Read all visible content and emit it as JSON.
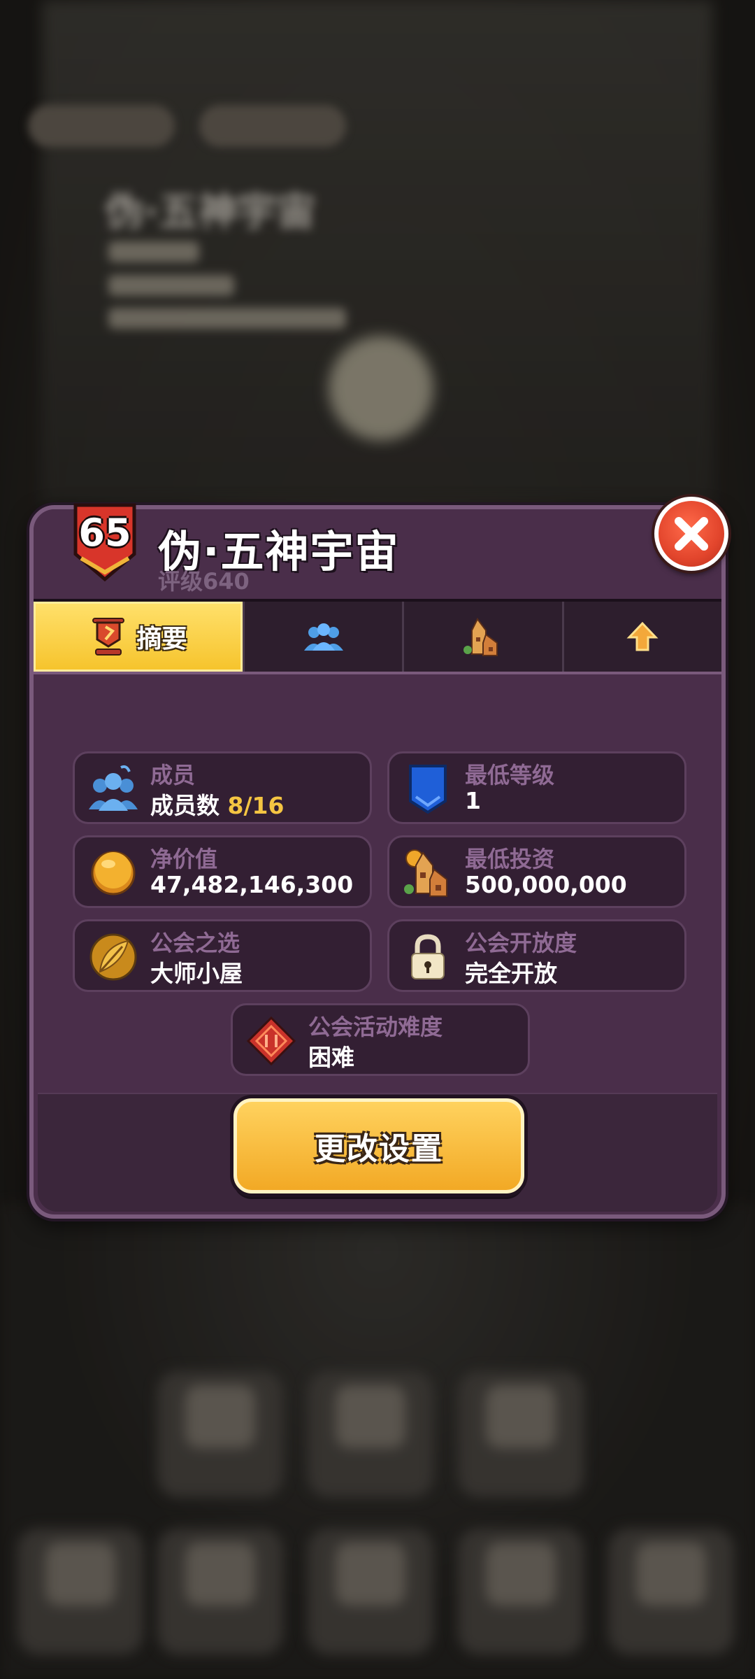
{
  "guild": {
    "level": "65",
    "name": "伪·五神宇宙",
    "rating": "评级640"
  },
  "tabs": [
    {
      "label": "摘要",
      "icon": "trophy-icon",
      "active": true
    },
    {
      "label": "",
      "icon": "members-icon",
      "active": false
    },
    {
      "label": "",
      "icon": "buildings-icon",
      "active": false
    },
    {
      "label": "",
      "icon": "upgrade-arrow-icon",
      "active": false
    }
  ],
  "stats": {
    "members": {
      "label": "成员",
      "value_prefix": "成员数 ",
      "value_count": "8/16",
      "icon": "members-icon"
    },
    "min_level": {
      "label": "最低等级",
      "value": "1",
      "icon": "blue-shield-icon"
    },
    "net_worth": {
      "label": "净价值",
      "value": "47,482,146,300",
      "icon": "gold-coin-icon"
    },
    "min_investment": {
      "label": "最低投资",
      "value": "500,000,000",
      "icon": "buildings-icon"
    },
    "guild_choice": {
      "label": "公会之选",
      "value": "大师小屋",
      "icon": "golden-feather-icon"
    },
    "openness": {
      "label": "公会开放度",
      "value": "完全开放",
      "icon": "padlock-icon"
    },
    "difficulty": {
      "label": "公会活动难度",
      "value": "困难",
      "icon": "red-diamond-icon"
    }
  },
  "actions": {
    "change_settings": "更改设置"
  },
  "colors": {
    "panel": "#4a2e4a",
    "accent_gold": "#f5c542",
    "close_red": "#e2452c"
  }
}
